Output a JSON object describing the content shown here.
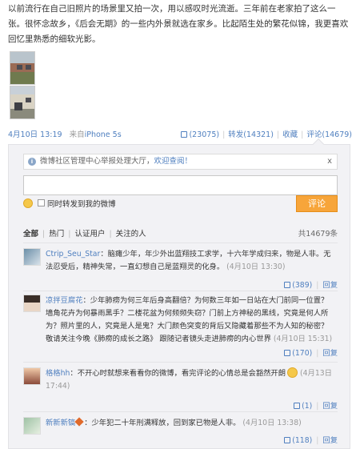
{
  "post": {
    "text": "以前流行在自己旧照片的场景里又拍一次，用以感叹时光流逝。三年前在老家拍了这么一张。很怀念故乡，《后会无期》的一些内外景就选在家乡。比起陌生处的繁花似锦，我更喜欢回忆里熟悉的细软光影。",
    "time": "4月10日 13:19",
    "source_prefix": "来自",
    "source": "iPhone 5s",
    "like_count": "(23075)",
    "repost_label": "转发(14321)",
    "fav_label": "收藏",
    "comment_label": "评论(14679)"
  },
  "panel": {
    "notice_text": "微博社区管理中心举报处理大厅，",
    "notice_link": "欢迎查阅！",
    "notice_close": "x",
    "input_placeholder": "",
    "repost_checkbox_label": "同时转发到我的微博",
    "submit_label": "评论",
    "filters": [
      "全部",
      "热门",
      "认证用户",
      "关注的人"
    ],
    "total_count": "共14679条"
  },
  "comments": [
    {
      "name": "Ctrip_Seu_Star",
      "text": "：脑瘫少年，年少外出蓝翔技工求学，十六年学成归来，物是人非。无法忍受后，精神失常，一直幻想自己是蓝翔灵的化身。",
      "time": "(4月10日 13:30)",
      "likes": "(389)",
      "reply": "回复"
    },
    {
      "name": "凉拌豆腐花",
      "text": "：少年肺痨为何三年后身高翻倍？为何数三年如一日站在大门前同一位置？墙角花卉为何暴雨黑手？二楼花盆为何频频失窃？门前上方神秘的黑线，究竟是何人所为？照片里的人，究竟是人是鬼？大门颜色突变的背后又隐藏着那些不为人知的秘密？敬请关注今晚《肺痨的成长之路》 跟随记者镜头走进肺痨的内心世界",
      "time": "(4月10日 15:31)",
      "likes": "(170)",
      "reply": "回复"
    },
    {
      "name": "格格hh",
      "text": "：不开心时就想来看看你的微博，看完评论的心情总是会豁然开朗",
      "time": "(4月13日 17:44)",
      "likes": "(1)",
      "reply": "回复"
    },
    {
      "name": "新新新镐",
      "text": "：少年犯二十年刑满释放，回到家已物是人非。",
      "time": "(4月10日 13:38)",
      "likes": "(118)",
      "reply": "回复"
    }
  ],
  "colors": {
    "link": "#4f7fbf",
    "submit": "#f7a53a",
    "panel_bg": "#f2f2f5"
  }
}
